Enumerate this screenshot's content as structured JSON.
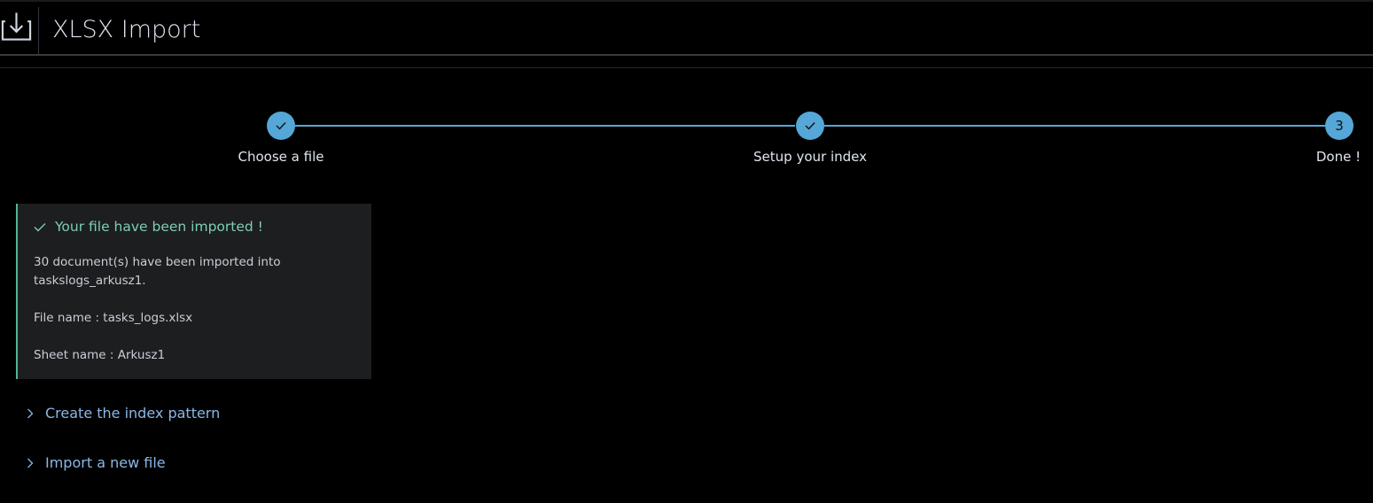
{
  "header": {
    "title": "XLSX Import",
    "icon": "download-icon"
  },
  "stepper": {
    "steps": [
      {
        "label": "Choose a file",
        "status": "complete",
        "marker": "check-icon"
      },
      {
        "label": "Setup your index",
        "status": "complete",
        "marker": "check-icon"
      },
      {
        "label": "Done !",
        "status": "current",
        "number": "3"
      }
    ],
    "accent_color": "#54a7d6"
  },
  "callout": {
    "title": "Your file have been imported !",
    "icon": "check-icon",
    "line1a": "30 document(s) have been imported into",
    "line1b": "taskslogs_arkusz1.",
    "file_name": "File name : tasks_logs.xlsx",
    "sheet_name": "Sheet name : Arkusz1",
    "accent_color": "#54b399"
  },
  "links": {
    "create_index_pattern": "Create the index pattern",
    "import_new_file": "Import a new file",
    "icon": "chevron-right-icon"
  }
}
